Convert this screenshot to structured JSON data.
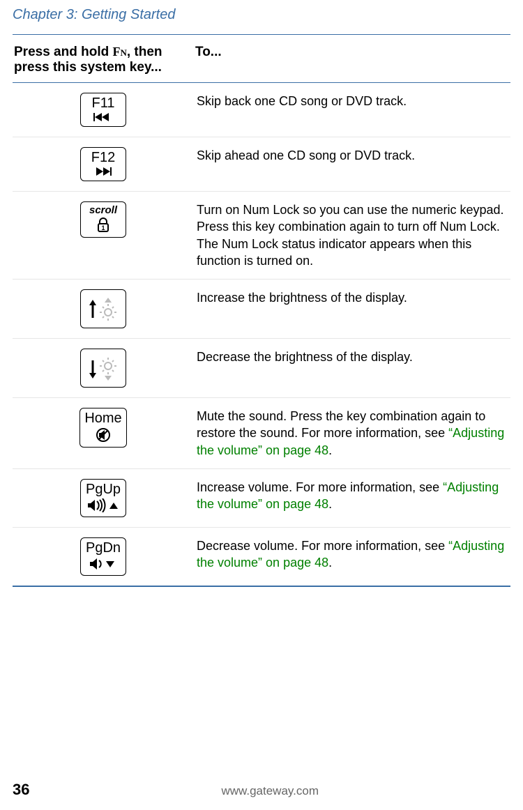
{
  "chapter": "Chapter 3: Getting Started",
  "table": {
    "header_key_pre": "Press and hold ",
    "header_key_fn": "Fn",
    "header_key_post": ", then press this system key...",
    "header_to": "To...",
    "rows": [
      {
        "label": "F11",
        "desc": "Skip back one CD song or DVD track."
      },
      {
        "label": "F12",
        "desc": "Skip ahead one CD song or DVD track."
      },
      {
        "label": "scroll",
        "desc": "Turn on Num Lock so you can use the numeric keypad. Press this key combination again to turn off Num Lock. The Num Lock status indicator appears when this function is turned on."
      },
      {
        "label": "",
        "desc": "Increase the brightness of the display."
      },
      {
        "label": "",
        "desc": "Decrease the brightness of the display."
      },
      {
        "label": "Home",
        "desc_pre": "Mute the sound. Press the key combination again to restore the sound. For more information, see ",
        "link": "“Adjusting the volume” on page 48",
        "desc_post": "."
      },
      {
        "label": "PgUp",
        "desc_pre": "Increase volume. For more information, see ",
        "link": "“Adjusting the volume” on page 48",
        "desc_post": "."
      },
      {
        "label": "PgDn",
        "desc_pre": "Decrease volume. For more information, see ",
        "link": "“Adjusting the volume” on page 48",
        "desc_post": "."
      }
    ]
  },
  "footer": {
    "page": "36",
    "url": "www.gateway.com"
  }
}
